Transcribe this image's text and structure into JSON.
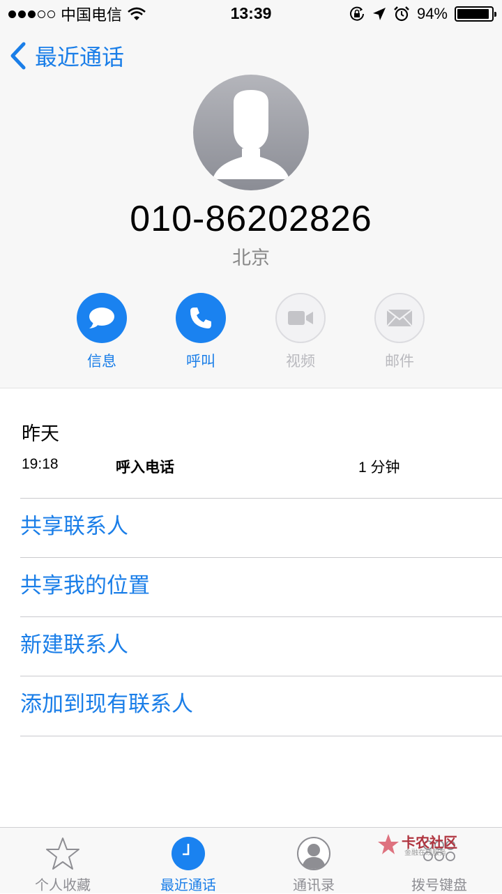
{
  "status_bar": {
    "carrier": "中国电信",
    "time": "13:39",
    "battery_percent_label": "94%",
    "battery_level": 0.94,
    "icons": [
      "signal-dots-icon",
      "wifi-icon",
      "orientation-lock-icon",
      "location-arrow-icon",
      "alarm-icon",
      "battery-icon"
    ]
  },
  "nav": {
    "back_label": "最近通话"
  },
  "contact": {
    "number": "010-86202826",
    "location": "北京"
  },
  "actions": [
    {
      "label": "信息",
      "icon": "message-bubble-icon",
      "enabled": true
    },
    {
      "label": "呼叫",
      "icon": "phone-icon",
      "enabled": true
    },
    {
      "label": "视频",
      "icon": "video-camera-icon",
      "enabled": false
    },
    {
      "label": "邮件",
      "icon": "mail-icon",
      "enabled": false
    }
  ],
  "call_history": {
    "date": "昨天",
    "time": "19:18",
    "type": "呼入电话",
    "duration": "1 分钟"
  },
  "options": [
    {
      "label": "共享联系人"
    },
    {
      "label": "共享我的位置"
    },
    {
      "label": "新建联系人"
    },
    {
      "label": "添加到现有联系人"
    }
  ],
  "tab_bar": {
    "tabs": [
      {
        "label": "个人收藏",
        "icon": "star-icon",
        "active": false
      },
      {
        "label": "最近通话",
        "icon": "clock-icon",
        "active": true
      },
      {
        "label": "通讯录",
        "icon": "contacts-icon",
        "active": false
      },
      {
        "label": "拨号键盘",
        "icon": "keypad-icon",
        "active": false
      }
    ]
  },
  "watermark": {
    "text": "卡农社区",
    "subtext": "金融在线服务"
  },
  "colors": {
    "accent": "#1a7ee8",
    "inactive": "#b9b9be",
    "background_top": "#f7f7f7"
  }
}
